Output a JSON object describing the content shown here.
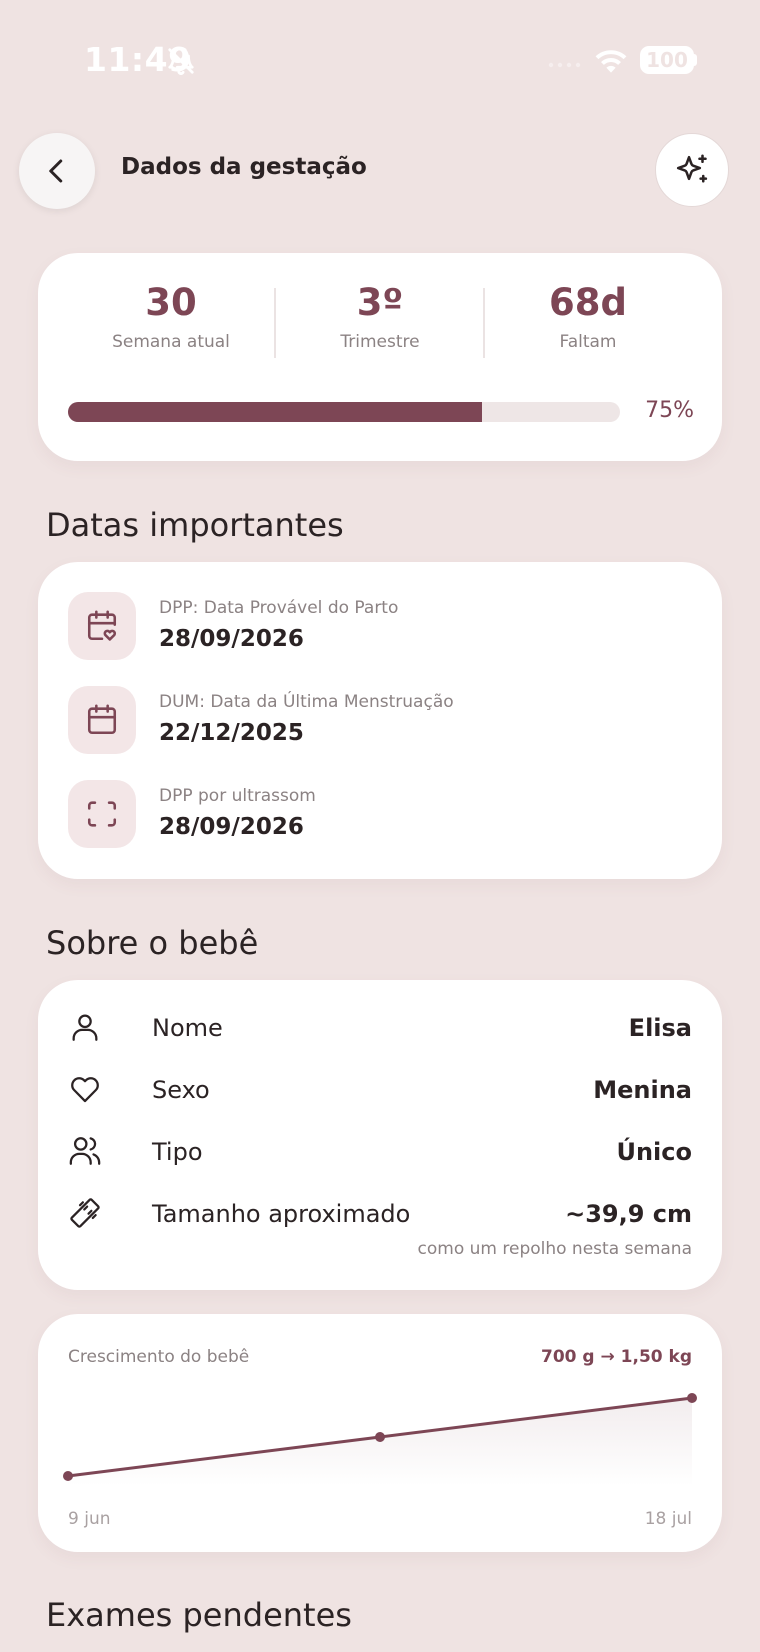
{
  "status_bar": {
    "time": "11:49",
    "battery": "100",
    "icons": [
      "bell-slash-icon",
      "cellular-signal-icon",
      "wifi-icon",
      "battery-icon"
    ]
  },
  "header": {
    "title": "Dados da gestação",
    "back_icon": "chevron-left-icon",
    "action_icon": "sparkles-icon"
  },
  "colors": {
    "accent": "#7d4655",
    "background": "#efe3e2",
    "card": "#ffffff",
    "muted_text": "#8b8283",
    "icon_box": "#f3e6e7"
  },
  "summary": {
    "stats": [
      {
        "value": "30",
        "label": "Semana atual"
      },
      {
        "value": "3º",
        "label": "Trimestre"
      },
      {
        "value": "68d",
        "label": "Faltam"
      }
    ],
    "progress_percent": 75,
    "progress_label": "75%"
  },
  "important_dates": {
    "title": "Datas importantes",
    "items": [
      {
        "icon": "calendar-heart-icon",
        "label": "DPP: Data Provável do Parto",
        "value": "28/09/2026"
      },
      {
        "icon": "calendar-icon",
        "label": "DUM: Data da Última Menstruação",
        "value": "22/12/2025"
      },
      {
        "icon": "scan-icon",
        "label": "DPP por ultrassom",
        "value": "28/09/2026"
      }
    ]
  },
  "baby": {
    "title": "Sobre o bebê",
    "rows": [
      {
        "icon": "user-icon",
        "label": "Nome",
        "value": "Elisa"
      },
      {
        "icon": "heart-icon",
        "label": "Sexo",
        "value": "Menina"
      },
      {
        "icon": "users-icon",
        "label": "Tipo",
        "value": "Único"
      },
      {
        "icon": "ruler-icon",
        "label": "Tamanho aproximado",
        "value": "~39,9 cm"
      }
    ],
    "size_note": "como um repolho nesta semana"
  },
  "growth": {
    "title": "Crescimento do bebê",
    "range_label": "700 g → 1,50 kg",
    "x_start_label": "9 jun",
    "x_end_label": "18 jul"
  },
  "chart_data": {
    "type": "line",
    "x": [
      "9 jun",
      "",
      "18 jul"
    ],
    "series": [
      {
        "values": [
          0.7,
          1.1,
          1.5
        ]
      }
    ],
    "ylim": [
      0.7,
      1.5
    ],
    "grid": false
  },
  "pending_exams": {
    "title": "Exames pendentes"
  }
}
